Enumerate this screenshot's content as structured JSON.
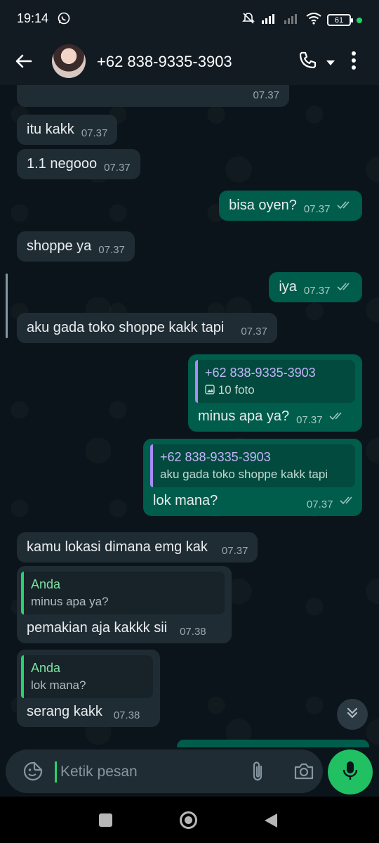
{
  "status_bar": {
    "time": "19:14",
    "battery": "61"
  },
  "header": {
    "contact_name": "+62 838-9335-3903"
  },
  "messages": [
    {
      "id": "m0",
      "direction": "in",
      "text": "",
      "time": "07.37"
    },
    {
      "id": "m1",
      "direction": "in",
      "text": "itu kakk",
      "time": "07.37"
    },
    {
      "id": "m2",
      "direction": "in",
      "text": "1.1 negooo",
      "time": "07.37"
    },
    {
      "id": "m3",
      "direction": "out",
      "text": "bisa oyen?",
      "time": "07.37",
      "read": true
    },
    {
      "id": "m4",
      "direction": "in",
      "text": "shoppe ya",
      "time": "07.37"
    },
    {
      "id": "m5",
      "direction": "out",
      "text": "iya",
      "time": "07.37",
      "read": true
    },
    {
      "id": "m6",
      "direction": "in",
      "text": "aku gada toko shoppe kakk tapi",
      "time": "07.37"
    },
    {
      "id": "m7",
      "direction": "out",
      "text": "minus apa ya?",
      "time": "07.37",
      "read": true,
      "quote": {
        "author": "+62 838-9335-3903",
        "text": "10 foto",
        "icon": "photo-icon"
      }
    },
    {
      "id": "m8",
      "direction": "out",
      "text": "lok mana?",
      "time": "07.37",
      "read": true,
      "quote": {
        "author": "+62 838-9335-3903",
        "text": "aku gada toko shoppe kakk tapi"
      }
    },
    {
      "id": "m9",
      "direction": "in",
      "text": "kamu lokasi dimana emg kak",
      "time": "07.37"
    },
    {
      "id": "m10",
      "direction": "in",
      "text": "pemakian aja kakkk sii",
      "time": "07.38",
      "quote": {
        "author": "Anda",
        "text": "minus apa ya?"
      }
    },
    {
      "id": "m11",
      "direction": "in",
      "text": "serang kakk",
      "time": "07.38",
      "quote": {
        "author": "Anda",
        "text": "lok mana?"
      }
    }
  ],
  "composer": {
    "placeholder": "Ketik pesan"
  },
  "colors": {
    "incoming_bubble": "#1f2c34",
    "outgoing_bubble": "#005c4b",
    "accent": "#21c063",
    "background": "#0b141a"
  },
  "icons": [
    "whatsapp-icon",
    "mute-icon",
    "signal-icon",
    "wifi-icon",
    "back-arrow-icon",
    "phone-icon",
    "caret-down-icon",
    "more-vert-icon",
    "double-check-icon",
    "photo-icon",
    "chevrons-down-icon",
    "sticker-icon",
    "paperclip-icon",
    "camera-icon",
    "mic-icon"
  ]
}
